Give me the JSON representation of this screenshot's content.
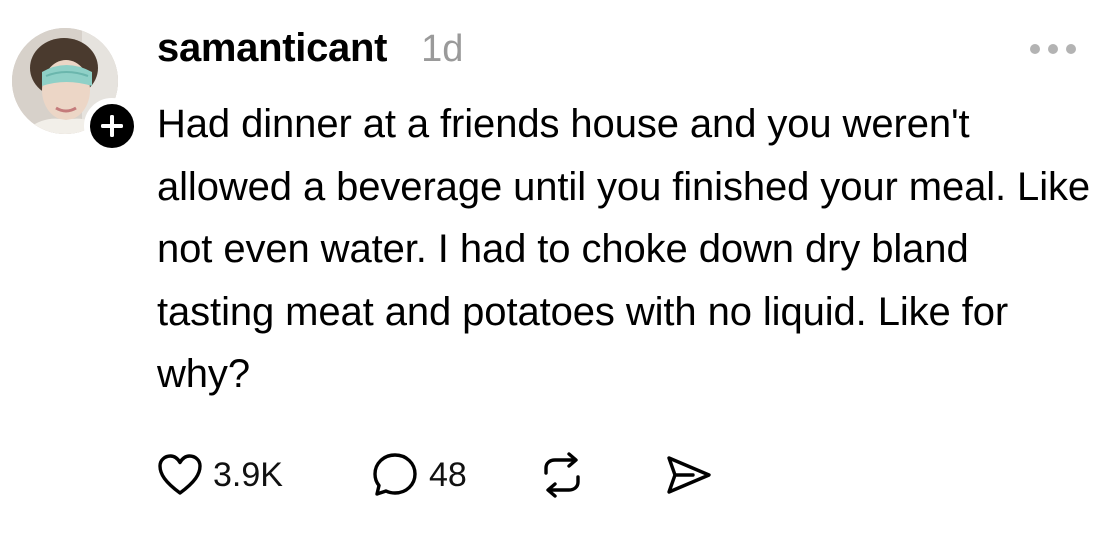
{
  "post": {
    "username": "samanticant",
    "timestamp": "1d",
    "body": "Had dinner at a friends house and you weren't allowed a beverage until you finished your meal. Like not even water. I had to choke down dry bland tasting meat and potatoes with no liquid. Like for why?",
    "likes": "3.9K",
    "replies": "48"
  },
  "icons": {
    "like": "heart-icon",
    "reply": "comment-bubble-icon",
    "repost": "repost-icon",
    "share": "send-icon",
    "more": "more-options-icon",
    "follow": "plus-icon"
  },
  "colors": {
    "text": "#000000",
    "muted": "#9a9a9a",
    "badge": "#000000"
  }
}
